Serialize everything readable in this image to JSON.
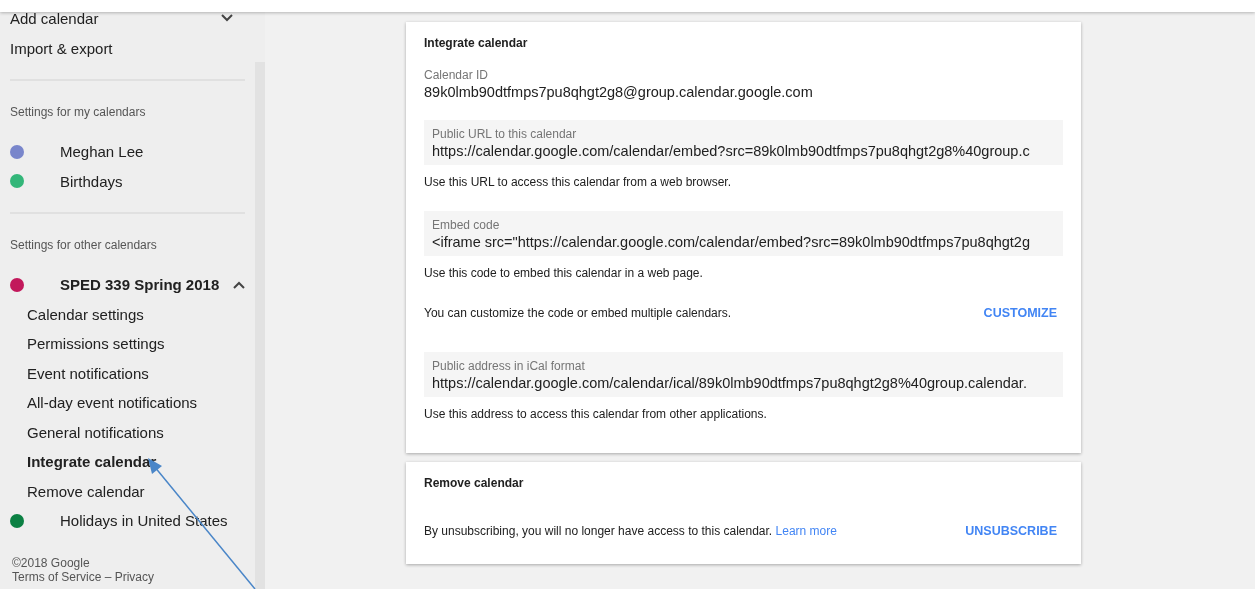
{
  "sidebar": {
    "top_items": [
      {
        "label": "Add calendar",
        "expanded": false
      },
      {
        "label": "Import & export"
      }
    ],
    "sections": [
      {
        "heading": "Settings for my calendars",
        "calendars": [
          {
            "name": "Meghan Lee",
            "color": "#7986cb"
          },
          {
            "name": "Birthdays",
            "color": "#33b679"
          }
        ]
      },
      {
        "heading": "Settings for other calendars",
        "calendars": [
          {
            "name": "SPED 339 Spring 2018",
            "color": "#c2185b",
            "expanded": true,
            "children": [
              {
                "label": "Calendar settings",
                "selected": false
              },
              {
                "label": "Permissions settings",
                "selected": false
              },
              {
                "label": "Event notifications",
                "selected": false
              },
              {
                "label": "All-day event notifications",
                "selected": false
              },
              {
                "label": "General notifications",
                "selected": false
              },
              {
                "label": "Integrate calendar",
                "selected": true
              },
              {
                "label": "Remove calendar",
                "selected": false
              }
            ]
          },
          {
            "name": "Holidays in United States",
            "color": "#0b8043"
          }
        ]
      }
    ],
    "footer": {
      "copyright": "©2018 Google",
      "links": "Terms of Service – Privacy"
    }
  },
  "cards": [
    {
      "title": "Integrate calendar",
      "items": [
        {
          "kind": "plain_field",
          "label": "Calendar ID",
          "value": "89k0lmb90dtfmps7pu8qhgt2g8@group.calendar.google.com"
        },
        {
          "kind": "boxed_field",
          "label": "Public URL to this calendar",
          "value": "https://calendar.google.com/calendar/embed?src=89k0lmb90dtfmps7pu8qhgt2g8%40group.c"
        },
        {
          "kind": "note",
          "text": "Use this URL to access this calendar from a web browser."
        },
        {
          "kind": "boxed_field",
          "label": "Embed code",
          "value": "<iframe src=\"https://calendar.google.com/calendar/embed?src=89k0lmb90dtfmps7pu8qhgt2g"
        },
        {
          "kind": "note",
          "text": "Use this code to embed this calendar in a web page."
        },
        {
          "kind": "action",
          "text": "You can customize the code or embed multiple calendars.",
          "button": "CUSTOMIZE"
        },
        {
          "kind": "boxed_field",
          "label": "Public address in iCal format",
          "value": "https://calendar.google.com/calendar/ical/89k0lmb90dtfmps7pu8qhgt2g8%40group.calendar."
        },
        {
          "kind": "note",
          "text": "Use this address to access this calendar from other applications."
        }
      ]
    },
    {
      "title": "Remove calendar",
      "items": [
        {
          "kind": "action",
          "text": "By unsubscribing, you will no longer have access to this calendar.",
          "link": "Learn more",
          "button": "UNSUBSCRIBE"
        }
      ]
    }
  ]
}
